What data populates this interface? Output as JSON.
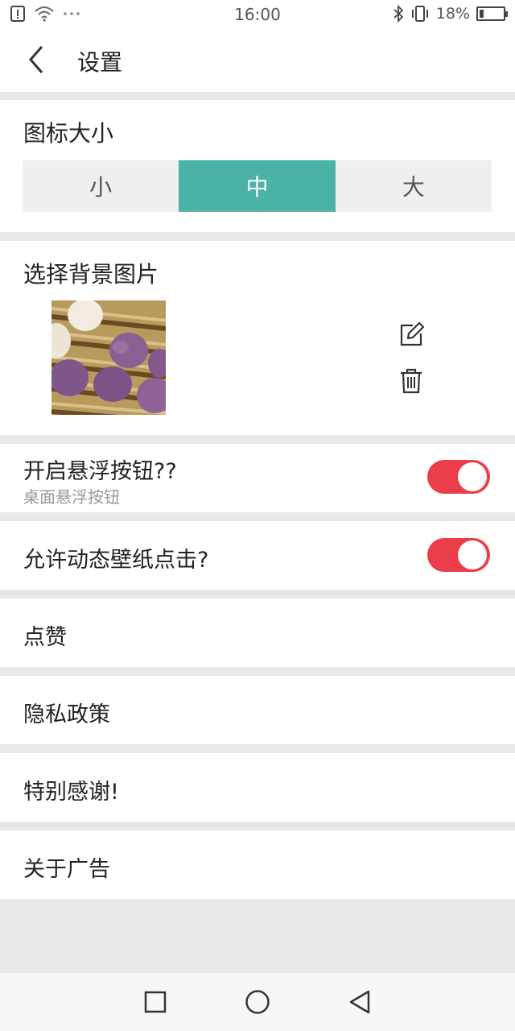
{
  "status_bar": {
    "time": "16:00",
    "battery_text": "18%",
    "icons": [
      "alert-icon",
      "wifi-icon",
      "more-dots-icon",
      "bluetooth-icon",
      "vibrate-icon",
      "battery-icon"
    ],
    "battery_level": 0.18
  },
  "app_bar": {
    "back_icon": "chevron-left-icon",
    "title": "设置"
  },
  "icon_size": {
    "title": "图标大小",
    "options": [
      "小",
      "中",
      "大"
    ],
    "selected": "中",
    "accent_color": "#4ab3a5"
  },
  "background_image": {
    "title": "选择背景图片",
    "edit_icon": "edit-icon",
    "delete_icon": "trash-icon"
  },
  "settings": {
    "floating_button": {
      "label": "开启悬浮按钮??",
      "sublabel": "桌面悬浮按钮",
      "enabled": true
    },
    "live_wallpaper_click": {
      "label": "允许动态壁纸点击?",
      "enabled": true
    },
    "toggle_color": "#ec3d4a"
  },
  "menu": {
    "like": "点赞",
    "privacy": "隐私政策",
    "thanks": "特别感谢!",
    "ads": "关于广告"
  },
  "nav_bar": {
    "icons": [
      "recent-apps-icon",
      "home-icon",
      "back-icon"
    ]
  }
}
